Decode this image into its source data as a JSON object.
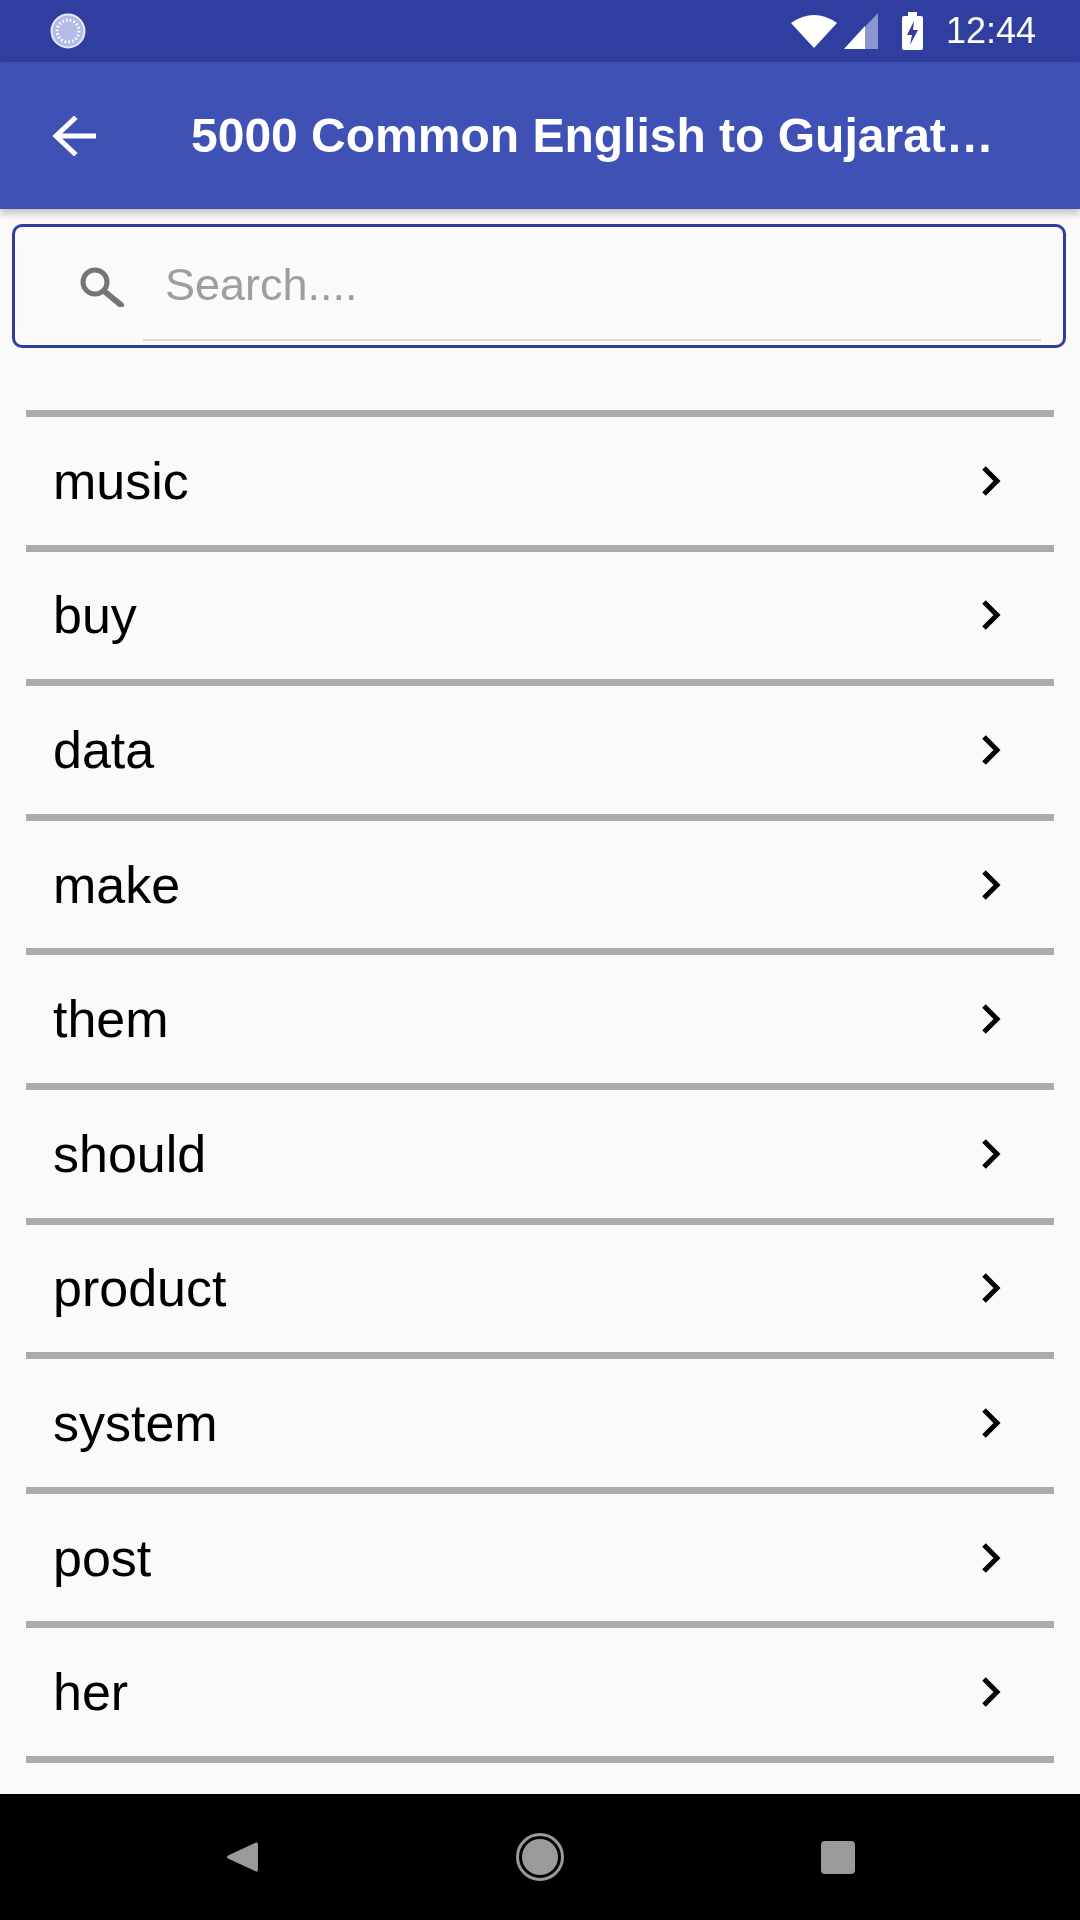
{
  "status_bar": {
    "time": "12:44"
  },
  "app_bar": {
    "title": "5000 Common English to Gujarat…"
  },
  "search": {
    "placeholder": "Search...."
  },
  "words": [
    "music",
    "buy",
    "data",
    "make",
    "them",
    "should",
    "product",
    "system",
    "post",
    "her"
  ]
}
